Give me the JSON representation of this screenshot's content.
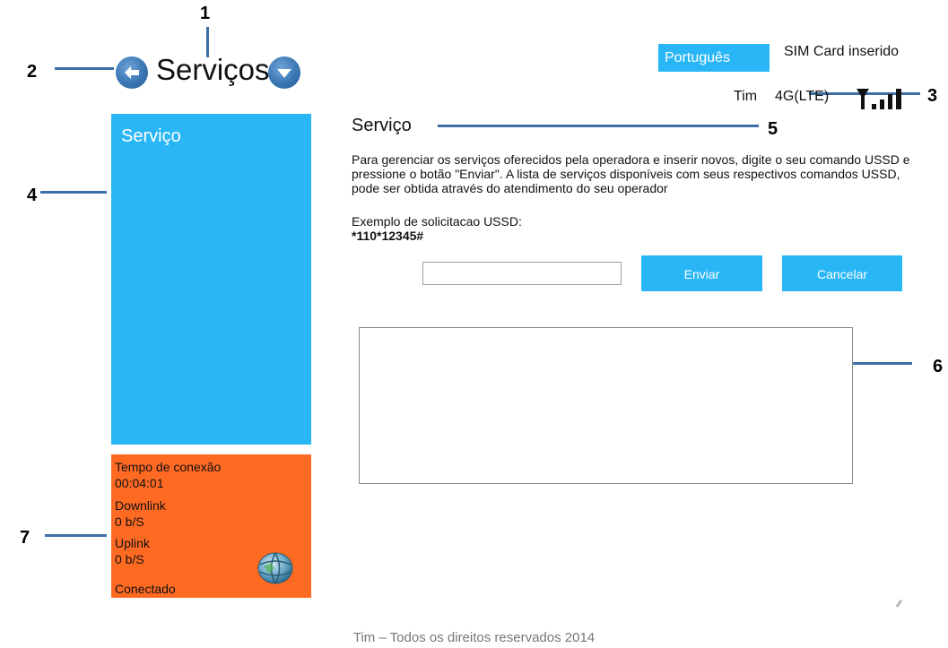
{
  "header": {
    "title": "Serviços",
    "back_icon": "arrow-left-icon",
    "menu_icon": "chevron-down-icon",
    "language": "Português",
    "sim_status": "SIM Card inserido",
    "operator": "Tim",
    "network": "4G(LTE)",
    "signal_icon": "signal-strength-icon"
  },
  "sidebar": {
    "items": [
      {
        "label": "Serviço"
      }
    ]
  },
  "stats": {
    "connection_time_label": "Tempo de conexão",
    "connection_time_value": "00:04:01",
    "downlink_label": "Downlink",
    "downlink_value": "0 b/S",
    "uplink_label": "Uplink",
    "uplink_value": "0 b/S",
    "status": "Conectado",
    "globe_icon": "globe-icon"
  },
  "main": {
    "section_title": "Serviço",
    "description": "Para gerenciar os serviços oferecidos pela operadora e inserir novos, digite o seu comando USSD e pressione o botão \"Enviar\". A lista de serviços disponíveis com seus respectivos comandos USSD, pode ser obtida através do atendimento do seu operador",
    "example_label": "Exemplo de solicitacao USSD:",
    "example_code": "*110*12345#",
    "ussd_input_value": "",
    "send_label": "Enviar",
    "cancel_label": "Cancelar",
    "response_value": ""
  },
  "callouts": [
    "1",
    "2",
    "3",
    "4",
    "5",
    "6",
    "7"
  ],
  "footer": {
    "text": "Tim – Todos os direitos reservados 2014"
  },
  "colors": {
    "accent_blue": "#29b6f6",
    "stats_orange": "#ff6a23",
    "callout_line": "#3d6ea8"
  }
}
